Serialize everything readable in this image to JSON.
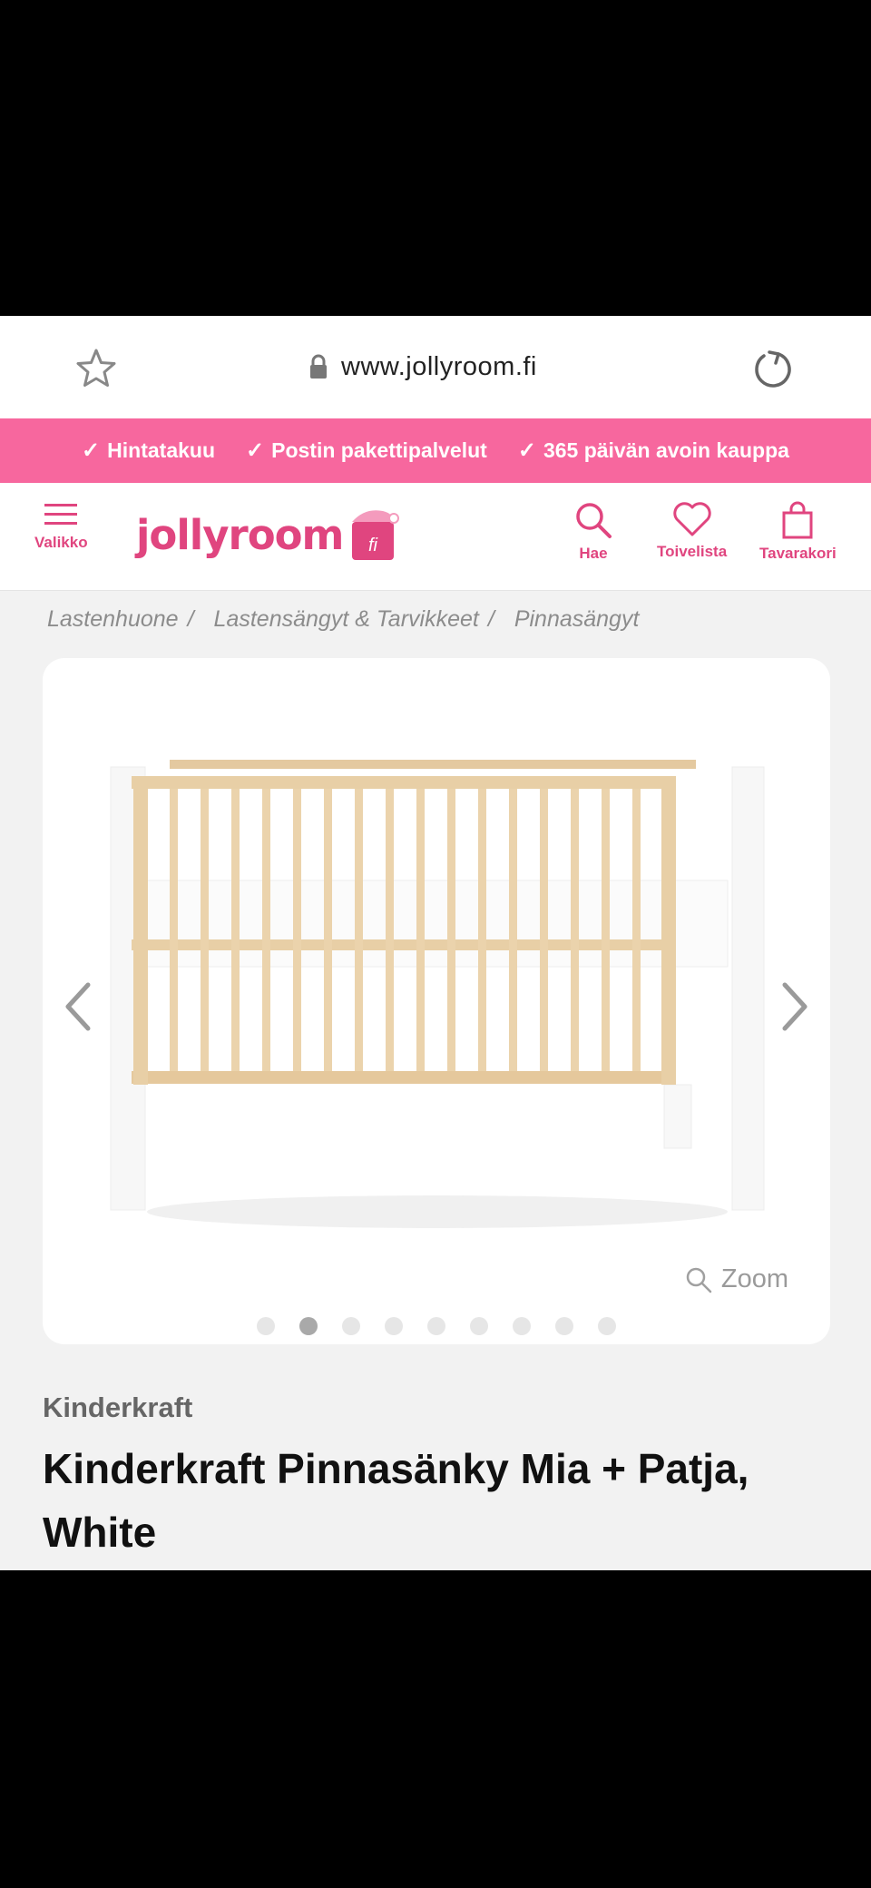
{
  "browser": {
    "url": "www.jollyroom.fi",
    "icons": [
      "star-icon",
      "lock-icon",
      "reload-icon"
    ]
  },
  "promo": {
    "items": [
      "Hintatakuu",
      "Postin pakettipalvelut",
      "365 päivän avoin kauppa"
    ],
    "color": "#f7679e"
  },
  "header": {
    "menu_label": "Valikko",
    "logo_text": "jollyroom",
    "logo_suffix": "fi",
    "search_label": "Hae",
    "wishlist_label": "Toivelista",
    "cart_label": "Tavarakori",
    "accent": "#e0457f"
  },
  "breadcrumb": [
    "Lastenhuone",
    "Lastensängyt & Tarvikkeet",
    "Pinnasängyt"
  ],
  "gallery": {
    "zoom_label": "Zoom",
    "dot_count": 9,
    "active_index": 1
  },
  "product": {
    "brand": "Kinderkraft",
    "title": "Kinderkraft Pinnasänky Mia + Patja, White"
  }
}
